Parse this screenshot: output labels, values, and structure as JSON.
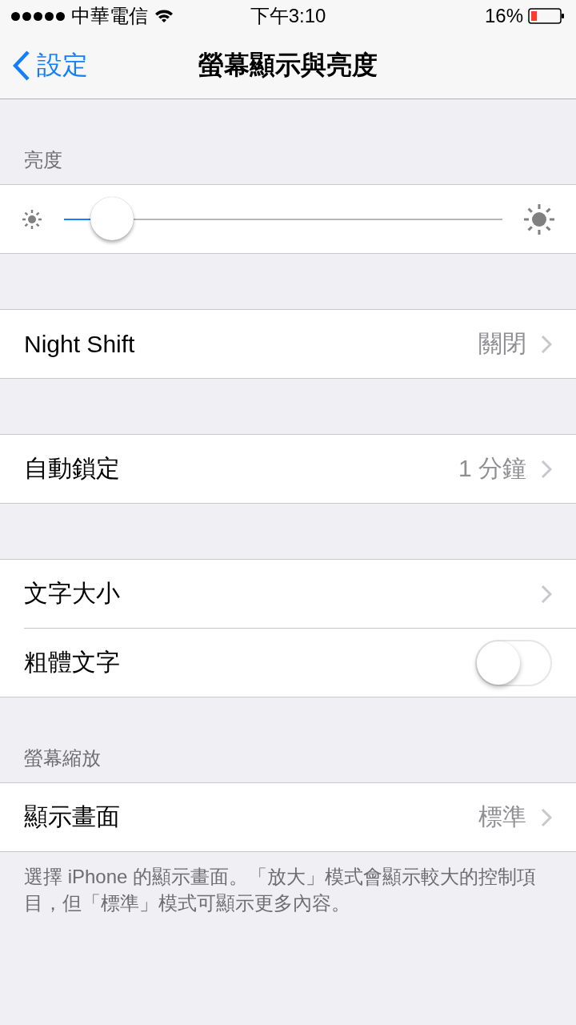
{
  "status_bar": {
    "carrier": "中華電信",
    "time": "下午3:10",
    "battery": "16%"
  },
  "nav": {
    "back": "設定",
    "title": "螢幕顯示與亮度"
  },
  "sections": [
    {
      "header": "亮度",
      "rows": [
        {
          "kind": "slider",
          "level": 0.11
        }
      ]
    },
    {
      "rows": [
        {
          "kind": "link",
          "label": "Night Shift",
          "value": "關閉"
        }
      ]
    },
    {
      "rows": [
        {
          "kind": "link",
          "label": "自動鎖定",
          "value": "1 分鐘"
        }
      ]
    },
    {
      "rows": [
        {
          "kind": "link",
          "label": "文字大小"
        },
        {
          "kind": "toggle",
          "label": "粗體文字",
          "on": false
        }
      ]
    },
    {
      "header": "螢幕縮放",
      "rows": [
        {
          "kind": "link",
          "label": "顯示畫面",
          "value": "標準"
        }
      ],
      "footer": "選擇 iPhone 的顯示畫面。「放大」模式會顯示較大的控制項目，但「標準」模式可顯示更多內容。"
    }
  ]
}
